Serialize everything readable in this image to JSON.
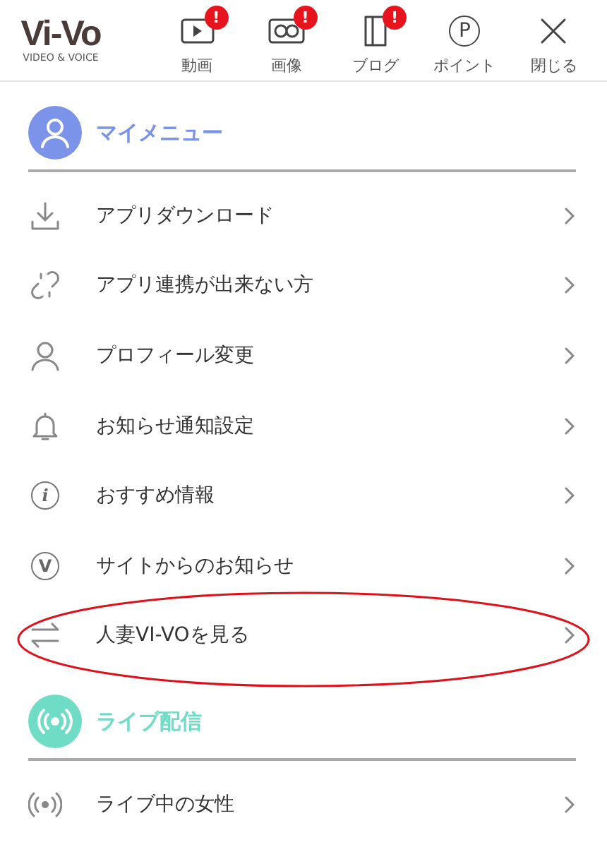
{
  "logo": {
    "mark": "Vi-Vo",
    "tagline": "VIDEO & VOICE"
  },
  "nav": [
    {
      "kind": "video",
      "label": "動画",
      "badge": "!"
    },
    {
      "kind": "image",
      "label": "画像",
      "badge": "!"
    },
    {
      "kind": "blog",
      "label": "ブログ",
      "badge": "!"
    },
    {
      "kind": "point",
      "label": "ポイント",
      "glyph": "P"
    },
    {
      "kind": "close",
      "label": "閉じる"
    }
  ],
  "sections": [
    {
      "kind": "user",
      "title": "マイメニュー",
      "color": "#7b93e8",
      "items": [
        {
          "kind": "download",
          "label": "アプリダウンロード",
          "highlighted": false
        },
        {
          "kind": "link",
          "label": "アプリ連携が出来ない方",
          "highlighted": false
        },
        {
          "kind": "user",
          "label": "プロフィール変更",
          "highlighted": false
        },
        {
          "kind": "bell",
          "label": "お知らせ通知設定",
          "highlighted": false
        },
        {
          "kind": "info",
          "label": "おすすめ情報",
          "highlighted": false,
          "glyph": "i"
        },
        {
          "kind": "v",
          "label": "サイトからのお知らせ",
          "highlighted": false,
          "glyph": "V"
        },
        {
          "kind": "swap",
          "label": "人妻VI-VOを見る",
          "highlighted": true
        }
      ]
    },
    {
      "kind": "live",
      "title": "ライブ配信",
      "color": "#6fdcc6",
      "items": [
        {
          "kind": "live",
          "label": "ライブ中の女性",
          "highlighted": false
        }
      ]
    }
  ]
}
